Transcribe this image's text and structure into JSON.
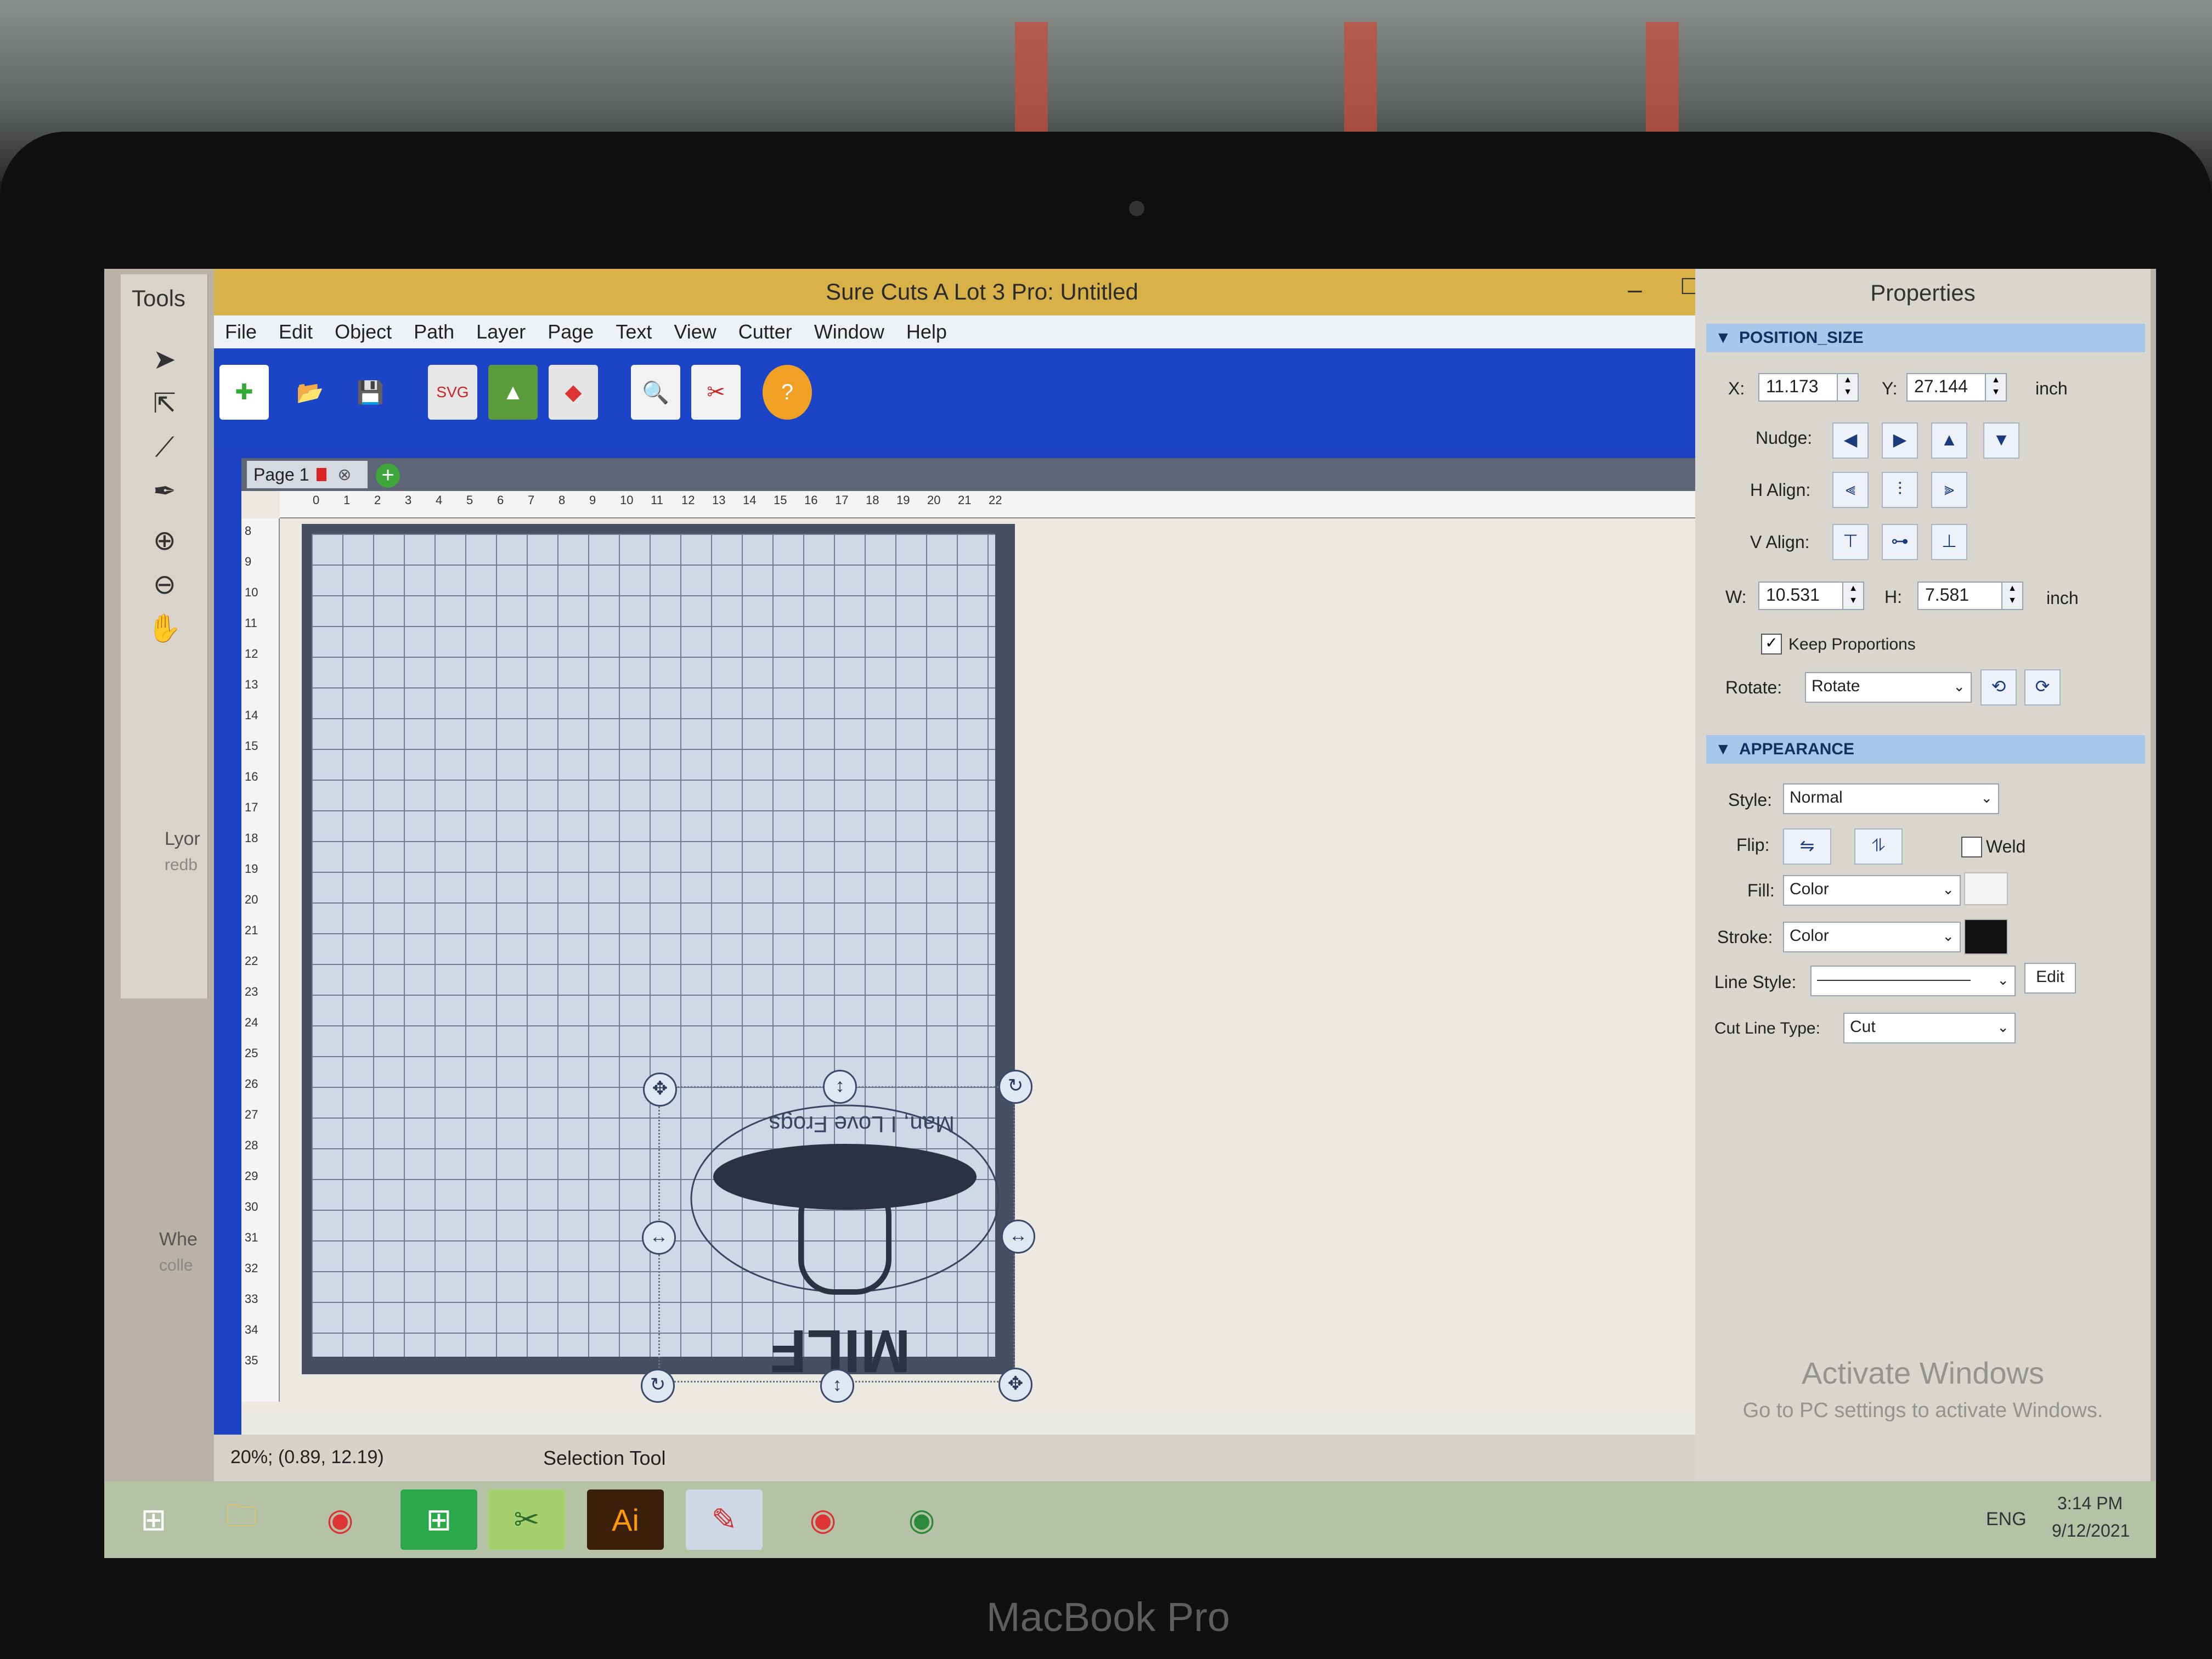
{
  "device": {
    "brand": "MacBook Pro"
  },
  "tools_panel": {
    "title": "Tools",
    "tools": [
      "select-arrow-icon",
      "node-edit-icon",
      "knife-icon",
      "pen-icon",
      "zoom-in-icon",
      "zoom-out-icon",
      "hand-pan-icon"
    ],
    "side_text_a": "Lyor",
    "side_text_b": "redb",
    "side_text_c": "Whe",
    "side_text_d": "colle"
  },
  "window": {
    "title": "Sure Cuts A Lot 3 Pro: Untitled",
    "min": "–",
    "max": "☐",
    "close": "✕"
  },
  "menu": [
    "File",
    "Edit",
    "Object",
    "Path",
    "Layer",
    "Page",
    "Text",
    "View",
    "Cutter",
    "Window",
    "Help"
  ],
  "toolbar": [
    "new-document-icon",
    "open-icon",
    "save-icon",
    "import-svg-icon",
    "import-image-icon",
    "import-shape-icon",
    "preview-icon",
    "cut-icon",
    "help-icon"
  ],
  "page_tab": {
    "label": "Page 1",
    "add": "+"
  },
  "ruler": {
    "top": [
      "0",
      "1",
      "2",
      "3",
      "4",
      "5",
      "6",
      "7",
      "8",
      "9",
      "10",
      "11",
      "12",
      "13",
      "14",
      "15",
      "16",
      "17",
      "18",
      "19",
      "20",
      "21",
      "22"
    ],
    "left": [
      "8",
      "9",
      "10",
      "11",
      "12",
      "13",
      "14",
      "15",
      "16",
      "17",
      "18",
      "19",
      "20",
      "21",
      "22",
      "23",
      "24",
      "25",
      "26",
      "27",
      "28",
      "29",
      "30",
      "31",
      "32",
      "33",
      "34",
      "35"
    ]
  },
  "artwork": {
    "arc_text": "Man, I Love Frogs",
    "bottom_text": "MILF"
  },
  "status": {
    "zoom": "20%; (0.89, 12.19)",
    "tool": "Selection Tool"
  },
  "properties": {
    "title": "Properties",
    "position_size": {
      "header": "POSITION_SIZE",
      "x_label": "X:",
      "x": "11.173",
      "y_label": "Y:",
      "y": "27.144",
      "unit": "inch",
      "nudge_label": "Nudge:",
      "halign_label": "H Align:",
      "valign_label": "V Align:",
      "w_label": "W:",
      "w": "10.531",
      "h_label": "H:",
      "h": "7.581",
      "unit2": "inch",
      "keep_proportions": "Keep Proportions",
      "rotate_label": "Rotate:",
      "rotate_value": "Rotate"
    },
    "appearance": {
      "header": "APPEARANCE",
      "style_label": "Style:",
      "style": "Normal",
      "flip_label": "Flip:",
      "weld": "Weld",
      "fill_label": "Fill:",
      "fill": "Color",
      "fill_swatch": "#f2f2f2",
      "stroke_label": "Stroke:",
      "stroke": "Color",
      "stroke_swatch": "#111111",
      "line_style_label": "Line Style:",
      "edit": "Edit",
      "cut_line_label": "Cut Line Type:",
      "cut_line": "Cut"
    },
    "watermark_1": "Activate Windows",
    "watermark_2": "Go to PC settings to activate Windows."
  },
  "taskbar": {
    "apps": [
      "windows-start-icon",
      "file-explorer-icon",
      "chrome-icon",
      "store-icon",
      "scal-icon",
      "illustrator-icon",
      "pen-app-icon",
      "chrome-user-icon",
      "chrome-icon-2"
    ],
    "illustrator": "Ai",
    "lang": "ENG",
    "time": "3:14 PM",
    "date": "9/12/2021"
  }
}
